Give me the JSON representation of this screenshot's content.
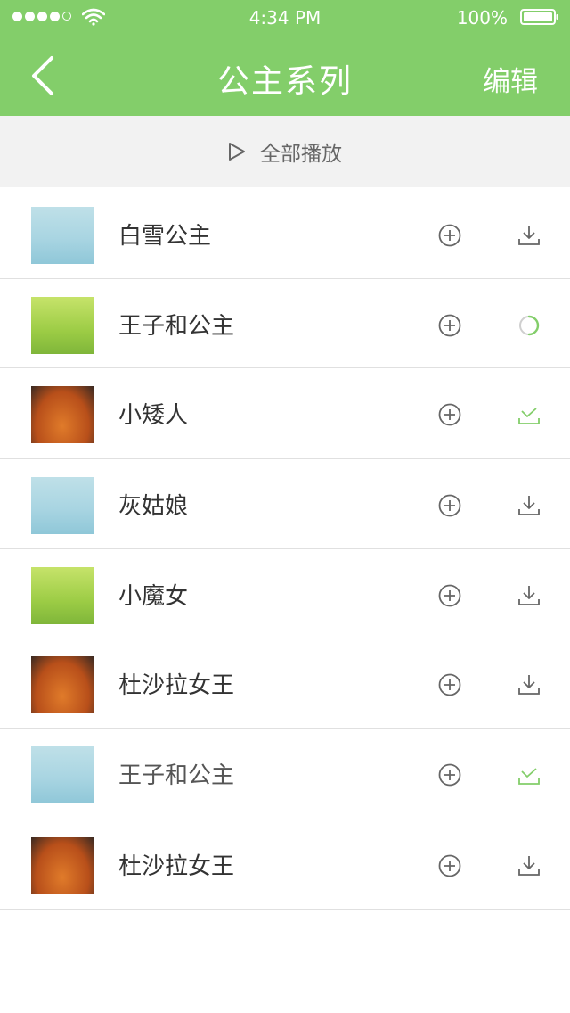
{
  "status_bar": {
    "time": "4:34 PM",
    "battery": "100%"
  },
  "nav": {
    "title": "公主系列",
    "edit_label": "编辑"
  },
  "play_all": {
    "label": "全部播放"
  },
  "colors": {
    "accent": "#83ce6a",
    "icon_gray": "#666666"
  },
  "songs": [
    {
      "title": "白雪公主",
      "status": "download-icon"
    },
    {
      "title": "王子和公主",
      "status": "loading-icon"
    },
    {
      "title": "小矮人",
      "status": "downloaded-check-icon"
    },
    {
      "title": "灰姑娘",
      "status": "download-icon"
    },
    {
      "title": "小魔女",
      "status": "download-icon"
    },
    {
      "title": "杜沙拉女王",
      "status": "download-icon"
    },
    {
      "title": "王子和公主",
      "status": "downloaded-check-icon"
    },
    {
      "title": "杜沙拉女王",
      "status": "download-icon"
    }
  ]
}
